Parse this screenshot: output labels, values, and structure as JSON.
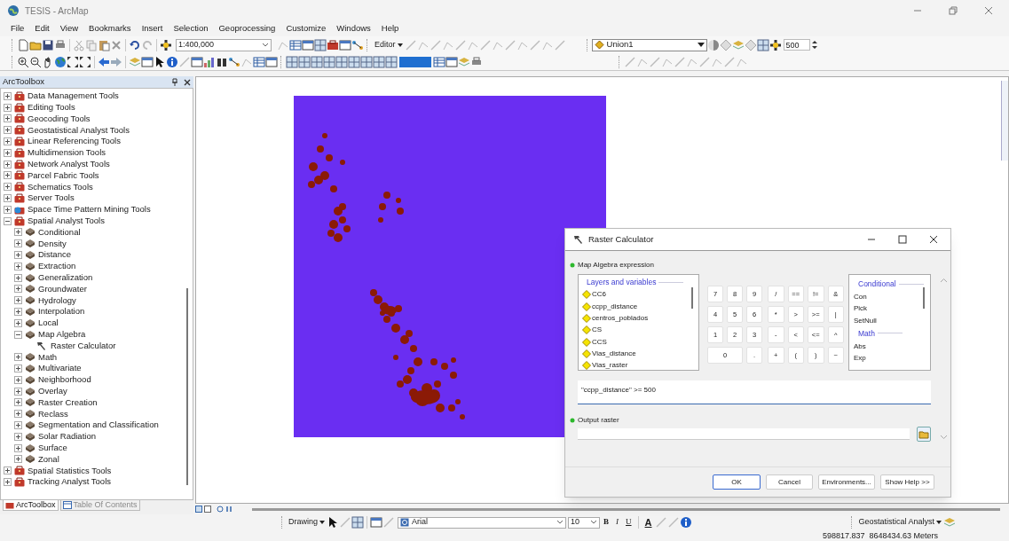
{
  "window": {
    "title": "TESIS - ArcMap"
  },
  "menu": [
    "File",
    "Edit",
    "View",
    "Bookmarks",
    "Insert",
    "Selection",
    "Geoprocessing",
    "Customize",
    "Windows",
    "Help"
  ],
  "standard_toolbar": {
    "scale": "1:400,000",
    "editor": "Editor",
    "layer": "Union1",
    "value": "500"
  },
  "toolbox": {
    "title": "ArcToolbox",
    "items": [
      {
        "label": "Data Management Tools",
        "kind": "toolbox",
        "expanded": false
      },
      {
        "label": "Editing Tools",
        "kind": "toolbox",
        "expanded": false
      },
      {
        "label": "Geocoding Tools",
        "kind": "toolbox",
        "expanded": false
      },
      {
        "label": "Geostatistical Analyst Tools",
        "kind": "toolbox",
        "expanded": false
      },
      {
        "label": "Linear Referencing Tools",
        "kind": "toolbox",
        "expanded": false
      },
      {
        "label": "Multidimension Tools",
        "kind": "toolbox",
        "expanded": false
      },
      {
        "label": "Network Analyst Tools",
        "kind": "toolbox",
        "expanded": false
      },
      {
        "label": "Parcel Fabric Tools",
        "kind": "toolbox",
        "expanded": false
      },
      {
        "label": "Schematics Tools",
        "kind": "toolbox",
        "expanded": false
      },
      {
        "label": "Server Tools",
        "kind": "toolbox",
        "expanded": false
      },
      {
        "label": "Space Time Pattern Mining Tools",
        "kind": "script_toolbox",
        "expanded": false
      },
      {
        "label": "Spatial Analyst Tools",
        "kind": "toolbox",
        "expanded": true,
        "children": [
          {
            "label": "Conditional",
            "kind": "toolset",
            "expanded": false
          },
          {
            "label": "Density",
            "kind": "toolset",
            "expanded": false
          },
          {
            "label": "Distance",
            "kind": "toolset",
            "expanded": false
          },
          {
            "label": "Extraction",
            "kind": "toolset",
            "expanded": false
          },
          {
            "label": "Generalization",
            "kind": "toolset",
            "expanded": false
          },
          {
            "label": "Groundwater",
            "kind": "toolset",
            "expanded": false
          },
          {
            "label": "Hydrology",
            "kind": "toolset",
            "expanded": false
          },
          {
            "label": "Interpolation",
            "kind": "toolset",
            "expanded": false
          },
          {
            "label": "Local",
            "kind": "toolset",
            "expanded": false
          },
          {
            "label": "Map Algebra",
            "kind": "toolset",
            "expanded": true,
            "children": [
              {
                "label": "Raster Calculator",
                "kind": "tool"
              }
            ]
          },
          {
            "label": "Math",
            "kind": "toolset",
            "expanded": false
          },
          {
            "label": "Multivariate",
            "kind": "toolset",
            "expanded": false
          },
          {
            "label": "Neighborhood",
            "kind": "toolset",
            "expanded": false
          },
          {
            "label": "Overlay",
            "kind": "toolset",
            "expanded": false
          },
          {
            "label": "Raster Creation",
            "kind": "toolset",
            "expanded": false
          },
          {
            "label": "Reclass",
            "kind": "toolset",
            "expanded": false
          },
          {
            "label": "Segmentation and Classification",
            "kind": "toolset",
            "expanded": false
          },
          {
            "label": "Solar Radiation",
            "kind": "toolset",
            "expanded": false
          },
          {
            "label": "Surface",
            "kind": "toolset",
            "expanded": false
          },
          {
            "label": "Zonal",
            "kind": "toolset",
            "expanded": false
          }
        ]
      },
      {
        "label": "Spatial Statistics Tools",
        "kind": "toolbox",
        "expanded": false
      },
      {
        "label": "Tracking Analyst Tools",
        "kind": "toolbox",
        "expanded": false
      }
    ]
  },
  "panel_tabs": [
    {
      "label": "ArcToolbox",
      "selected": true
    },
    {
      "label": "Table Of Contents",
      "selected": false
    }
  ],
  "dialog": {
    "title": "Raster Calculator",
    "expression_label": "Map Algebra expression",
    "layers_header": "Layers and variables",
    "layers": [
      "CC6",
      "ccpp_distance",
      "centros_poblados",
      "CS",
      "CCS",
      "Vias_distance",
      "Vias_raster"
    ],
    "keypad_digits": [
      {
        "label": "7",
        "wide": false
      },
      {
        "label": "8",
        "wide": false
      },
      {
        "label": "9",
        "wide": false
      },
      {
        "label": "4",
        "wide": false
      },
      {
        "label": "5",
        "wide": false
      },
      {
        "label": "6",
        "wide": false
      },
      {
        "label": "1",
        "wide": false
      },
      {
        "label": "2",
        "wide": false
      },
      {
        "label": "3",
        "wide": false
      },
      {
        "label": "0",
        "wide": true
      },
      {
        "label": ".",
        "wide": false
      }
    ],
    "keypad_operators": [
      "/",
      "==",
      "!=",
      "&",
      "*",
      ">",
      ">=",
      "|",
      "-",
      "<",
      "<=",
      "^",
      "+",
      "(",
      ")",
      "~"
    ],
    "functions": [
      {
        "label": "Conditional",
        "kind": "header"
      },
      {
        "label": "Con",
        "kind": "function"
      },
      {
        "label": "Pick",
        "kind": "function"
      },
      {
        "label": "SetNull",
        "kind": "function"
      },
      {
        "label": "Math",
        "kind": "header"
      },
      {
        "label": "Abs",
        "kind": "function"
      },
      {
        "label": "Exp",
        "kind": "function"
      }
    ],
    "expression": "\"ccpp_distance\" >= 500",
    "output_label": "Output raster",
    "buttons": [
      "OK",
      "Cancel",
      "Environments...",
      "Show Help >>"
    ]
  },
  "drawing_toolbar": {
    "label": "Drawing",
    "font": "Arial",
    "size": "10",
    "bold": "B",
    "italic": "I",
    "underline": "U",
    "font_color": "A"
  },
  "geostatistical_toolbar": {
    "label": "Geostatistical Analyst"
  },
  "status_bar": {
    "coordinates": "598817.837  8648434.63 Meters"
  }
}
